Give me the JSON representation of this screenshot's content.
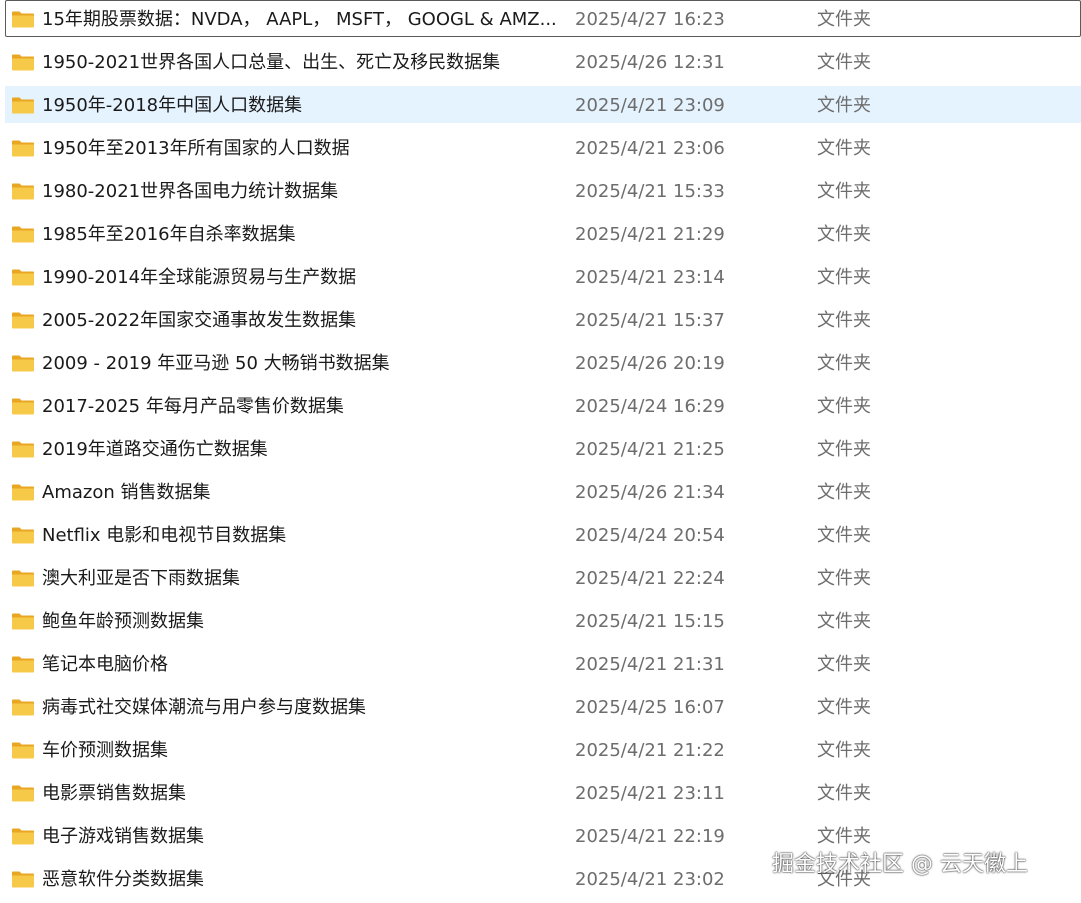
{
  "colors": {
    "folder_body": "#f7c948",
    "folder_tab": "#e8a623",
    "selected_row": "#e5f3ff",
    "focus_border": "#5a5a5a"
  },
  "icon": "folder-icon",
  "rows": [
    {
      "name": "15年期股票数据：NVDA， AAPL， MSFT， GOOGL & AMZ...",
      "date": "2025/4/27 16:23",
      "type": "文件夹",
      "state": "focused"
    },
    {
      "name": "1950-2021世界各国人口总量、出生、死亡及移民数据集",
      "date": "2025/4/26 12:31",
      "type": "文件夹",
      "state": ""
    },
    {
      "name": "1950年-2018年中国人口数据集",
      "date": "2025/4/21 23:09",
      "type": "文件夹",
      "state": "selected"
    },
    {
      "name": "1950年至2013年所有国家的人口数据",
      "date": "2025/4/21 23:06",
      "type": "文件夹",
      "state": ""
    },
    {
      "name": "1980-2021世界各国电力统计数据集",
      "date": "2025/4/21 15:33",
      "type": "文件夹",
      "state": ""
    },
    {
      "name": "1985年至2016年自杀率数据集",
      "date": "2025/4/21 21:29",
      "type": "文件夹",
      "state": ""
    },
    {
      "name": "1990-2014年全球能源贸易与生产数据",
      "date": "2025/4/21 23:14",
      "type": "文件夹",
      "state": ""
    },
    {
      "name": "2005-2022年国家交通事故发生数据集",
      "date": "2025/4/21 15:37",
      "type": "文件夹",
      "state": ""
    },
    {
      "name": "2009 - 2019 年亚马逊 50 大畅销书数据集",
      "date": "2025/4/26 20:19",
      "type": "文件夹",
      "state": ""
    },
    {
      "name": "2017-2025 年每月产品零售价数据集",
      "date": "2025/4/24 16:29",
      "type": "文件夹",
      "state": ""
    },
    {
      "name": "2019年道路交通伤亡数据集",
      "date": "2025/4/21 21:25",
      "type": "文件夹",
      "state": ""
    },
    {
      "name": "Amazon 销售数据集",
      "date": "2025/4/26 21:34",
      "type": "文件夹",
      "state": ""
    },
    {
      "name": "Netflix 电影和电视节目数据集",
      "date": "2025/4/24 20:54",
      "type": "文件夹",
      "state": ""
    },
    {
      "name": "澳大利亚是否下雨数据集",
      "date": "2025/4/21 22:24",
      "type": "文件夹",
      "state": ""
    },
    {
      "name": "鲍鱼年龄预测数据集",
      "date": "2025/4/21 15:15",
      "type": "文件夹",
      "state": ""
    },
    {
      "name": "笔记本电脑价格",
      "date": "2025/4/21 21:31",
      "type": "文件夹",
      "state": ""
    },
    {
      "name": "病毒式社交媒体潮流与用户参与度数据集",
      "date": "2025/4/25 16:07",
      "type": "文件夹",
      "state": ""
    },
    {
      "name": "车价预测数据集",
      "date": "2025/4/21 21:22",
      "type": "文件夹",
      "state": ""
    },
    {
      "name": "电影票销售数据集",
      "date": "2025/4/21 23:11",
      "type": "文件夹",
      "state": ""
    },
    {
      "name": "电子游戏销售数据集",
      "date": "2025/4/21 22:19",
      "type": "文件夹",
      "state": ""
    },
    {
      "name": "恶意软件分类数据集",
      "date": "2025/4/21 23:02",
      "type": "文件夹",
      "state": ""
    }
  ],
  "watermark": "掘金技术社区 @ 云天徽上"
}
